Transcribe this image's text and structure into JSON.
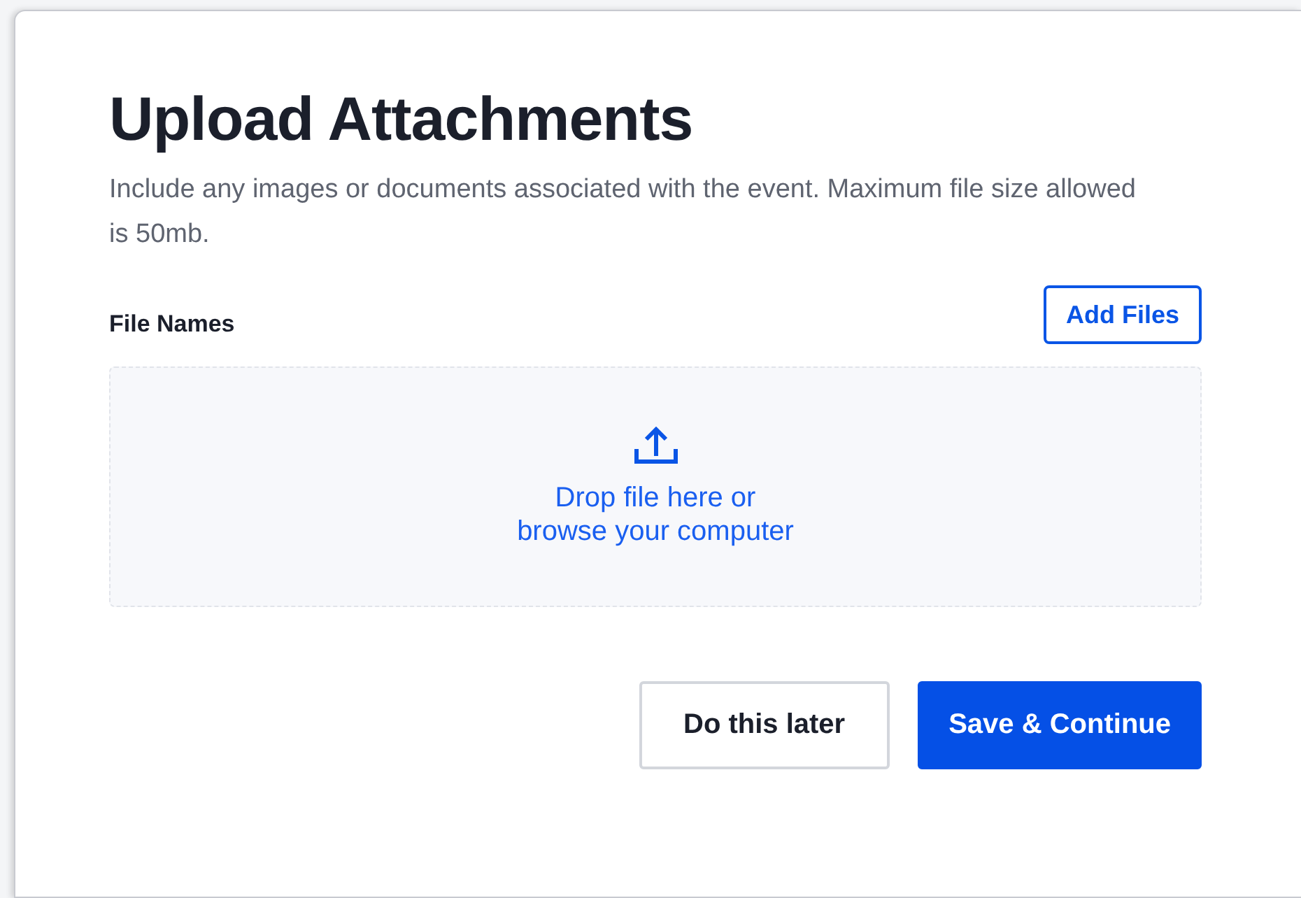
{
  "title": "Upload Attachments",
  "description": "Include any images or documents associated with the event. Maximum file size allowed is 50mb.",
  "files_label": "File Names",
  "add_button": "Add Files",
  "dropzone": {
    "lines": [
      "Drop file here or",
      "browse your computer"
    ]
  },
  "buttons": [
    {
      "label": "Do this later",
      "kind": "secondary"
    },
    {
      "label": "Save & Continue",
      "kind": "primary"
    }
  ]
}
